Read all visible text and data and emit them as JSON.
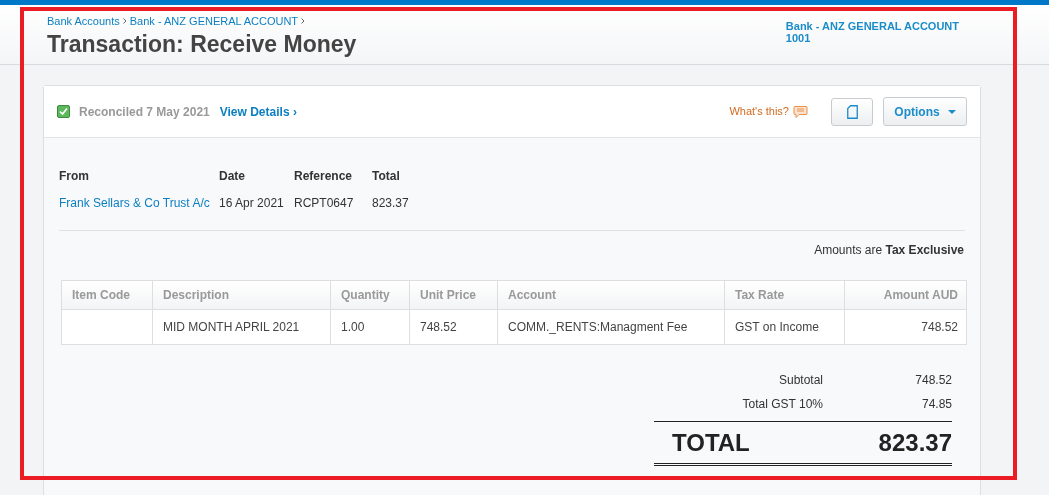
{
  "breadcrumbs": [
    "Bank Accounts",
    "Bank - ANZ GENERAL ACCOUNT"
  ],
  "title": "Transaction: Receive Money",
  "account": {
    "name": "Bank - ANZ GENERAL ACCOUNT",
    "number": "1001"
  },
  "status": {
    "reconciled": true,
    "text": "Reconciled 7 May 2021",
    "link": "View Details ›"
  },
  "help_link": "What's this?",
  "options_button": "Options",
  "summary": {
    "columns": [
      "From",
      "Date",
      "Reference",
      "Total"
    ],
    "values": [
      "Frank Sellars & Co Trust A/c",
      "16 Apr 2021",
      "RCPT0647",
      "823.37"
    ]
  },
  "tax_note": "Amounts are **Tax Exclusive**",
  "table": {
    "columns": [
      "Item Code",
      "Description",
      "Quantity",
      "Unit Price",
      "Account",
      "Tax Rate",
      "Amount AUD"
    ],
    "rows": [
      [
        null,
        "MID MONTH APRIL 2021",
        "1.00",
        "748.52",
        "COMM._RENTS:Managment Fee",
        "GST on Income",
        "748.52"
      ]
    ]
  },
  "totals": [
    {
      "label": "Subtotal",
      "value": "748.52"
    },
    {
      "label": "Total GST 10%",
      "value": "74.85"
    }
  ],
  "grand_total": {
    "label": "TOTAL",
    "value": "823.37"
  }
}
